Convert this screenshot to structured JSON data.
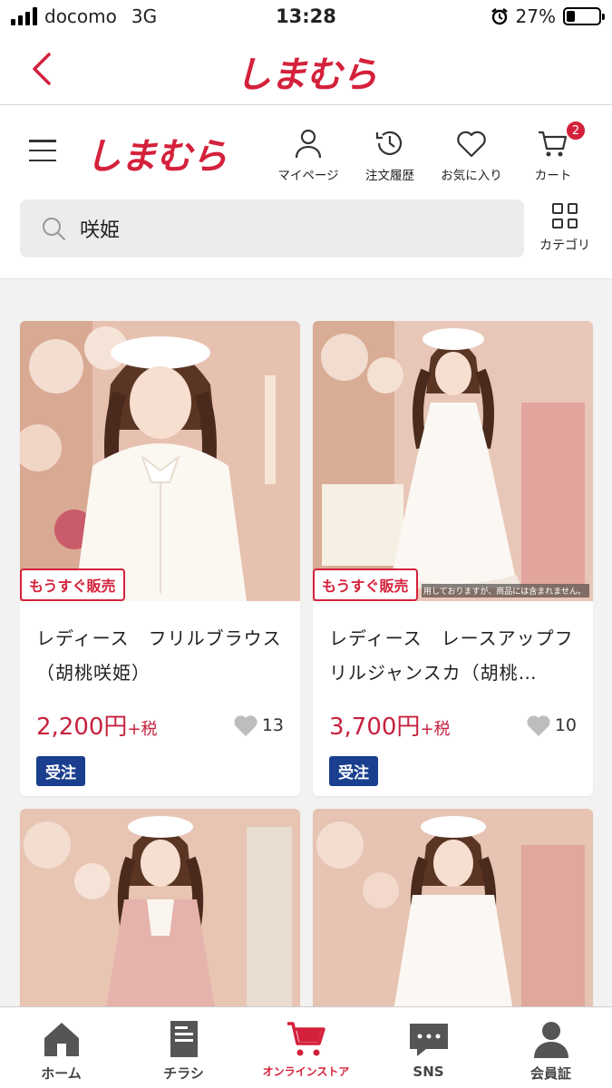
{
  "status_bar": {
    "carrier": "docomo",
    "network": "3G",
    "time": "13:28",
    "battery": "27%",
    "battery_level": 0.27
  },
  "app_nav": {
    "logo": "しまむら"
  },
  "site_header": {
    "logo": "しまむら",
    "icons": [
      {
        "label": "マイページ",
        "icon": "person-icon"
      },
      {
        "label": "注文履歴",
        "icon": "history-icon"
      },
      {
        "label": "お気に入り",
        "icon": "heart-icon"
      },
      {
        "label": "カート",
        "icon": "cart-icon"
      }
    ],
    "cart_count": "2",
    "search": {
      "value": "咲姫"
    },
    "category_label": "カテゴリ"
  },
  "products": [
    {
      "badge": "もうすぐ販売",
      "name": "レディース　フリルブラウス（胡桃咲姫）",
      "price": "2,200円",
      "tax": "+税",
      "likes": "13",
      "tag": "受注"
    },
    {
      "badge": "もうすぐ販売",
      "name": "レディース　レースアップフリルジャンスカ（胡桃…",
      "price": "3,700円",
      "tax": "+税",
      "likes": "10",
      "tag": "受注",
      "photo_note": "用しておりますが、商品には含まれません。"
    },
    {
      "name": ""
    },
    {
      "name": ""
    }
  ],
  "tab_bar": [
    {
      "label": "ホーム",
      "icon": "home-icon"
    },
    {
      "label": "チラシ",
      "icon": "flyer-icon"
    },
    {
      "label": "オンラインストア",
      "icon": "cart-icon",
      "active": true
    },
    {
      "label": "SNS",
      "icon": "chat-icon"
    },
    {
      "label": "会員証",
      "icon": "member-icon"
    }
  ],
  "colors": {
    "brand": "#d4213b",
    "price": "#c6223f",
    "tag": "#1a3f8f"
  }
}
